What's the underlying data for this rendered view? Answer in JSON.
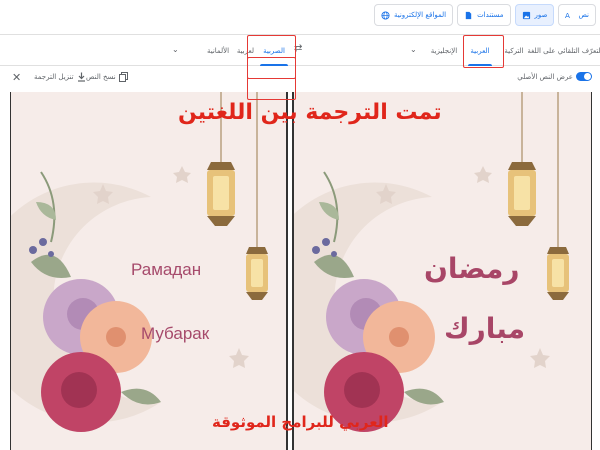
{
  "modes": {
    "text": "نص",
    "images": "صور",
    "documents": "مستندات",
    "websites": "المواقع الإلكترونية"
  },
  "source_langs": {
    "detect": "التعرّف التلقائي على اللغة",
    "turkish": "التركية",
    "arabic": "العربية",
    "english": "الإنجليزية"
  },
  "target_langs": {
    "serbian": "الصربية",
    "other": "لعربية",
    "german": "الألمانية"
  },
  "toolbar": {
    "show_original": "عرض النص الأصلي",
    "copy_text": "نسخ النص",
    "download": "تنزيل الترجمة"
  },
  "overlay": {
    "headline": "تمت الترجمة بين اللغتين",
    "footer": "العربي للبرامج الموثوقة"
  },
  "card": {
    "original_line1": "رمضان",
    "original_line2": "مبارك",
    "translated_line1": "Рамадан",
    "translated_line2": "Мубарак"
  },
  "colors": {
    "accent": "#1a73e8",
    "highlight_box": "#e53935",
    "overlay_text": "#e0261b",
    "card_bg": "#f6ece9",
    "greeting": "#a84667"
  }
}
